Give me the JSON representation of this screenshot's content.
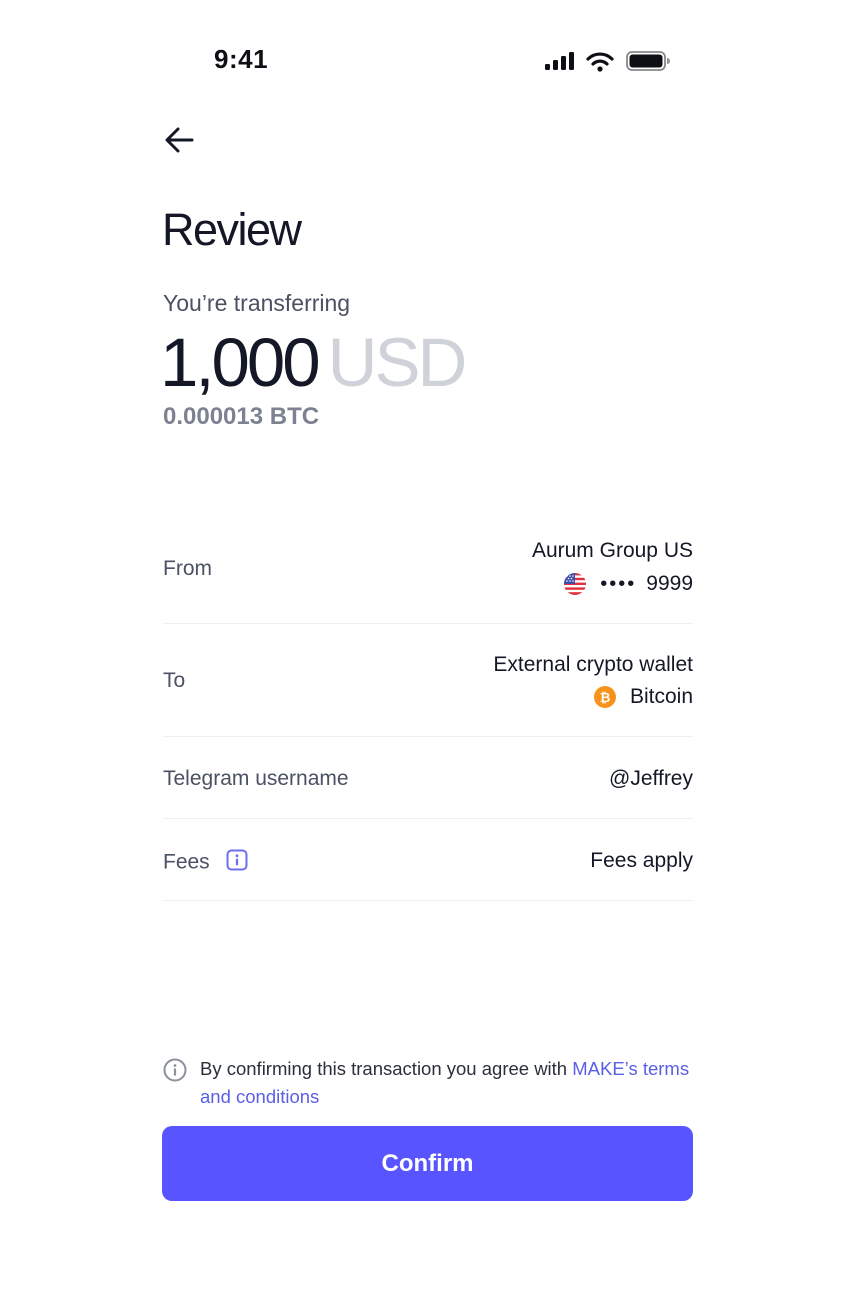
{
  "status_bar": {
    "time": "9:41",
    "icons": [
      "cellular-signal-icon",
      "wifi-icon",
      "battery-icon"
    ]
  },
  "header": {
    "back_icon": "arrow-left-icon",
    "title": "Review"
  },
  "transfer": {
    "label": "You’re transferring",
    "amount": "1,000",
    "currency": "USD",
    "crypto_equivalent": "0.000013 BTC"
  },
  "details": {
    "from": {
      "label": "From",
      "name": "Aurum Group US",
      "flag_icon": "us-flag-icon",
      "masked": "••••",
      "last4": "9999"
    },
    "to": {
      "label": "To",
      "name": "External crypto wallet",
      "asset_icon": "bitcoin-icon",
      "asset": "Bitcoin"
    },
    "telegram": {
      "label": "Telegram username",
      "value": "@Jeffrey"
    },
    "fees": {
      "label": "Fees",
      "info_icon": "info-icon",
      "value": "Fees apply"
    }
  },
  "disclaimer": {
    "text": "By confirming this transaction you agree with ",
    "link_text": "MAKE’s terms and conditions"
  },
  "actions": {
    "confirm_label": "Confirm"
  },
  "colors": {
    "accent": "#5854ff",
    "link": "#5a5fe8",
    "bitcoin": "#f7931a",
    "muted_currency": "#cfd2d9"
  }
}
